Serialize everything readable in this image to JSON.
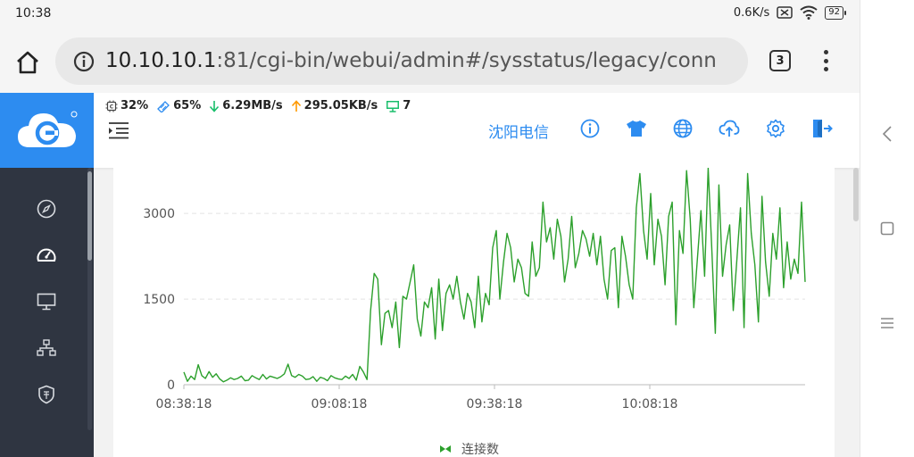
{
  "status_bar": {
    "time": "10:38",
    "net_speed": "0.6K/s",
    "battery": "92"
  },
  "browser": {
    "url_host": "10.10.10.1",
    "url_rest": ":81/cgi-bin/webui/admin#/sysstatus/legacy/conn",
    "tab_count": "3"
  },
  "top_stats": {
    "cpu": "32%",
    "memory": "65%",
    "download": "6.29MB/s",
    "upload": "295.05KB/s",
    "devices": "7"
  },
  "header": {
    "isp_name": "沈阳电信"
  },
  "colors": {
    "brand_blue": "#2d8cf0",
    "sidebar_dark": "#2f3541",
    "line_green": "#2ca02c",
    "download_green": "#19be6b",
    "upload_orange": "#ff9900"
  },
  "chart_data": {
    "type": "line",
    "x_ticks": [
      "08:38:18",
      "09:08:18",
      "09:38:18",
      "10:08:18"
    ],
    "y_ticks": [
      "0",
      "1500",
      "3000"
    ],
    "ylim": [
      0,
      3800
    ],
    "legend": "连接数",
    "series": [
      {
        "name": "连接数",
        "values": [
          220,
          60,
          150,
          90,
          350,
          160,
          110,
          230,
          130,
          190,
          100,
          50,
          80,
          120,
          90,
          110,
          150,
          70,
          80,
          160,
          120,
          90,
          180,
          100,
          150,
          130,
          110,
          140,
          190,
          360,
          160,
          130,
          180,
          150,
          90,
          100,
          140,
          60,
          130,
          110,
          70,
          160,
          120,
          100,
          90,
          150,
          110,
          180,
          80,
          320,
          220,
          90,
          1300,
          1950,
          1850,
          700,
          1250,
          1300,
          1000,
          1450,
          650,
          1550,
          1500,
          1800,
          2100,
          1150,
          850,
          1450,
          1350,
          1700,
          800,
          1850,
          950,
          1600,
          1750,
          1500,
          1900,
          1450,
          1150,
          1600,
          1450,
          1000,
          1900,
          1100,
          1600,
          1400,
          2400,
          2700,
          1500,
          2150,
          2650,
          2400,
          1800,
          2200,
          2050,
          1600,
          1550,
          2500,
          1900,
          2050,
          3200,
          2500,
          2750,
          2200,
          2900,
          2600,
          1800,
          2200,
          2950,
          2050,
          2300,
          2700,
          2550,
          2250,
          2650,
          2100,
          2600,
          1850,
          1500,
          2350,
          2400,
          1350,
          2600,
          2250,
          1750,
          1500,
          3100,
          3700,
          2700,
          2200,
          3350,
          2100,
          2900,
          2600,
          1750,
          2950,
          3200,
          1050,
          2700,
          2300,
          3750,
          2900,
          1350,
          2200,
          3050,
          1900,
          3800,
          2400,
          900,
          3500,
          1900,
          2450,
          2800,
          1300,
          2200,
          3100,
          1000,
          3700,
          2650,
          2100,
          1100,
          3300,
          2150,
          1550,
          2650,
          2200,
          3100,
          1700,
          2500,
          1850,
          2200,
          1950,
          3200,
          1800
        ]
      }
    ]
  }
}
